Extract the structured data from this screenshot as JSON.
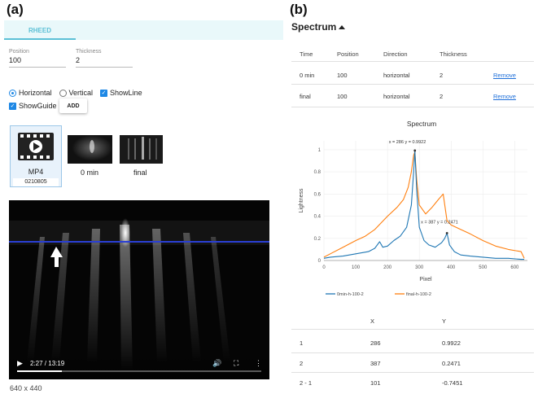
{
  "panels": {
    "left_label": "(a)",
    "right_label": "(b)"
  },
  "rheed": {
    "tab_label": "RHEED",
    "position": {
      "label": "Position",
      "value": "100"
    },
    "thickness": {
      "label": "Thickness",
      "value": "2"
    },
    "options": {
      "horizontal": "Horizontal",
      "vertical": "Vertical",
      "showline": "ShowLine",
      "showguide": "ShowGuide"
    },
    "add_label": "ADD",
    "mp4": {
      "label": "MP4",
      "sublabel": "0210805"
    },
    "thumbnails": [
      {
        "label": "0 min"
      },
      {
        "label": "final"
      }
    ],
    "video": {
      "time": "2:27 / 13:19",
      "progress": 0.184
    },
    "size_text": "640 x 440"
  },
  "spectrum": {
    "title": "Spectrum",
    "table": {
      "headers": [
        "Time",
        "Position",
        "Direction",
        "Thickness"
      ],
      "rows": [
        {
          "time": "0 min",
          "position": "100",
          "direction": "horizontal",
          "thickness": "2",
          "action": "Remove"
        },
        {
          "time": "final",
          "position": "100",
          "direction": "horizontal",
          "thickness": "2",
          "action": "Remove"
        }
      ]
    },
    "results": {
      "headers": [
        "X",
        "Y"
      ],
      "rows": [
        {
          "id": "1",
          "x": "286",
          "y": "0.9922"
        },
        {
          "id": "2",
          "x": "387",
          "y": "0.2471"
        },
        {
          "id": "2 - 1",
          "x": "101",
          "y": "-0.7451"
        }
      ]
    }
  },
  "colors": {
    "accent": "#5bc0d6",
    "blue_series": "#1f77b4",
    "orange_series": "#ff7f0e",
    "link": "#1e6fd9"
  },
  "chart_data": {
    "type": "line",
    "title": "Spectrum",
    "xlabel": "Pixel",
    "ylabel": "Lightness",
    "xlim": [
      0,
      640
    ],
    "ylim": [
      0,
      1.08
    ],
    "xticks": [
      "0",
      "100",
      "200",
      "300",
      "400",
      "500",
      "600"
    ],
    "yticks": [
      "0",
      "0.2",
      "0.4",
      "0.6",
      "0.8",
      "1"
    ],
    "legend_position": "bottom",
    "annotations": [
      {
        "text": "x = 286 y = 0.9922",
        "x": 286,
        "y": 0.9922
      },
      {
        "text": "x = 387 y = 0.2471",
        "x": 387,
        "y": 0.2471
      }
    ],
    "series": [
      {
        "name": "0min-h-100-2",
        "x": [
          0,
          20,
          60,
          100,
          140,
          160,
          175,
          185,
          200,
          220,
          240,
          260,
          275,
          282,
          286,
          292,
          300,
          315,
          330,
          350,
          370,
          380,
          387,
          395,
          410,
          430,
          460,
          500,
          540,
          580,
          620,
          630
        ],
        "y": [
          0.02,
          0.03,
          0.04,
          0.06,
          0.08,
          0.11,
          0.17,
          0.12,
          0.13,
          0.18,
          0.22,
          0.3,
          0.5,
          0.8,
          0.9922,
          0.62,
          0.3,
          0.18,
          0.14,
          0.12,
          0.16,
          0.2,
          0.2471,
          0.14,
          0.08,
          0.05,
          0.04,
          0.03,
          0.02,
          0.02,
          0.01,
          0.01
        ]
      },
      {
        "name": "final-h-100-2",
        "x": [
          0,
          20,
          60,
          100,
          130,
          160,
          180,
          200,
          230,
          250,
          265,
          275,
          282,
          286,
          292,
          300,
          320,
          340,
          360,
          375,
          387,
          400,
          430,
          460,
          500,
          540,
          580,
          620,
          630
        ],
        "y": [
          0.03,
          0.06,
          0.12,
          0.18,
          0.22,
          0.28,
          0.34,
          0.4,
          0.48,
          0.55,
          0.66,
          0.8,
          0.95,
          0.98,
          0.72,
          0.5,
          0.42,
          0.48,
          0.55,
          0.6,
          0.36,
          0.32,
          0.28,
          0.24,
          0.18,
          0.13,
          0.1,
          0.08,
          0.02
        ]
      }
    ]
  }
}
